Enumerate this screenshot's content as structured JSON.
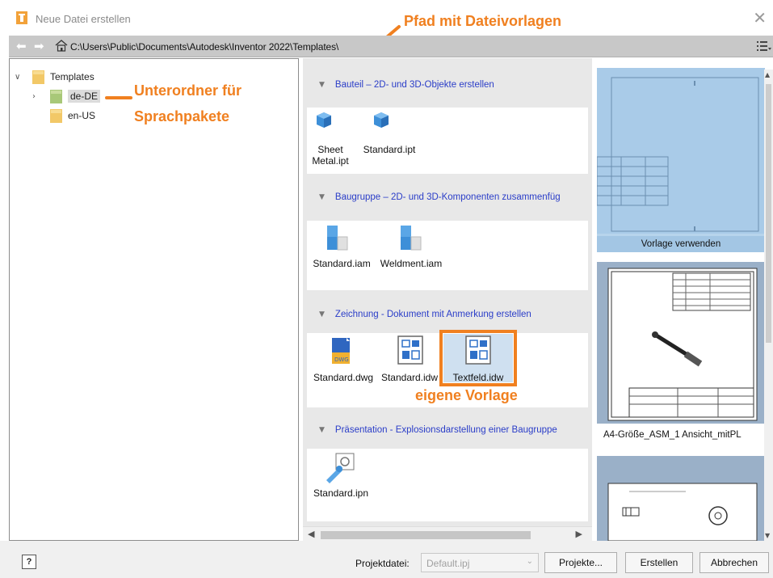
{
  "window": {
    "title": "Neue Datei erstellen",
    "close_icon": "close-icon"
  },
  "pathbar": {
    "path": "C:\\Users\\Public\\Documents\\Autodesk\\Inventor 2022\\Templates\\"
  },
  "annotations": {
    "path_note": "Pfad mit Dateivorlagen",
    "subfolder_note_line1": "Unterordner für",
    "subfolder_note_line2": "Sprachpakete",
    "own_template_note": "eigene Vorlage",
    "color": "#f08020"
  },
  "tree": {
    "root": "Templates",
    "children": [
      {
        "label": "de-DE",
        "selected": true
      },
      {
        "label": "en-US",
        "selected": false
      }
    ]
  },
  "categories": [
    {
      "header": "Bauteil – 2D- und 3D-Objekte erstellen",
      "items": [
        {
          "line1": "Sheet",
          "line2": "Metal.ipt",
          "icon": "part-icon"
        },
        {
          "line1": "Standard.ipt",
          "line2": "",
          "icon": "part-icon"
        }
      ]
    },
    {
      "header": "Baugruppe – 2D- und 3D-Komponenten zusammenfüg",
      "items": [
        {
          "line1": "Standard.iam",
          "icon": "assembly-icon"
        },
        {
          "line1": "Weldment.iam",
          "icon": "assembly-icon"
        }
      ]
    },
    {
      "header": "Zeichnung - Dokument mit Anmerkung erstellen",
      "items": [
        {
          "line1": "Standard.dwg",
          "icon": "dwg-icon"
        },
        {
          "line1": "Standard.idw",
          "icon": "drawing-icon"
        },
        {
          "line1": "Textfeld.idw",
          "icon": "drawing-icon"
        }
      ]
    },
    {
      "header": "Präsentation - Explosionsdarstellung einer Baugruppe",
      "items": [
        {
          "line1": "Standard.ipn",
          "icon": "presentation-icon"
        }
      ]
    }
  ],
  "preview": {
    "use_template": "Vorlage verwenden",
    "caption2": "A4-Größe_ASM_1 Ansicht_mitPL"
  },
  "footer": {
    "help": "?",
    "project_label": "Projektdatei:",
    "project_value": "Default.ipj",
    "projects_button": "Projekte...",
    "create_button": "Erstellen",
    "cancel_button": "Abbrechen"
  }
}
